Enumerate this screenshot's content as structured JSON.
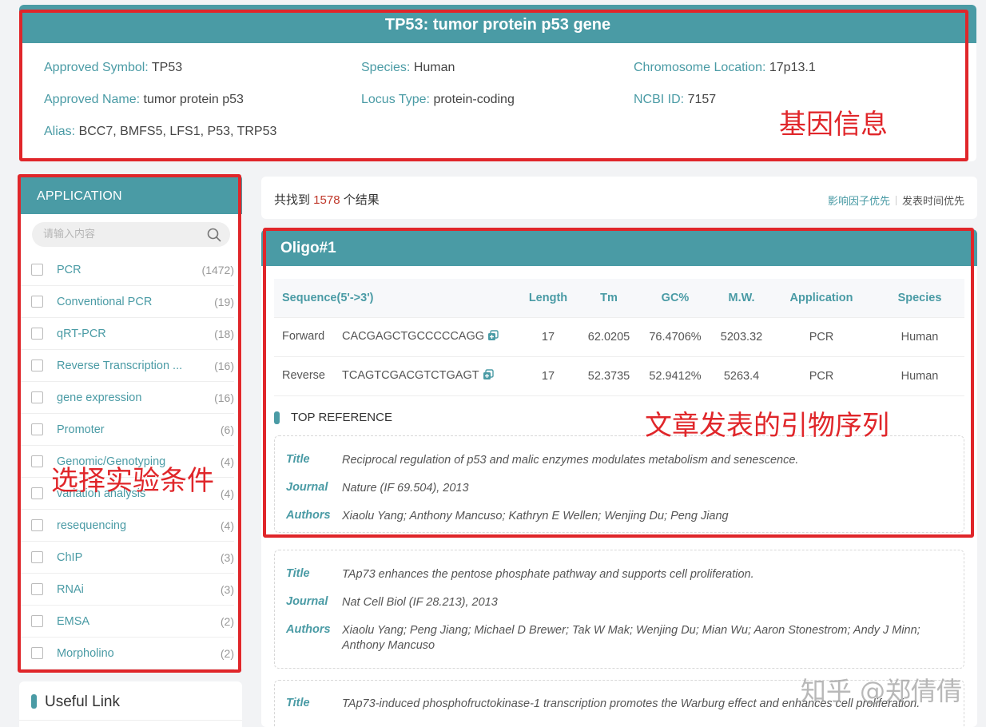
{
  "gene": {
    "title": "TP53: tumor protein p53 gene",
    "fields": {
      "approved_symbol_label": "Approved Symbol:",
      "approved_symbol": "TP53",
      "species_label": "Species:",
      "species": "Human",
      "chrom_label": "Chromosome Location:",
      "chrom": "17p13.1",
      "approved_name_label": "Approved Name:",
      "approved_name": "tumor protein p53",
      "locus_label": "Locus Type:",
      "locus": "protein-coding",
      "ncbi_label": "NCBI ID:",
      "ncbi": "7157",
      "alias_label": "Alias:",
      "alias": "BCC7, BMFS5, LFS1, P53, TRP53"
    }
  },
  "sidebar": {
    "title": "APPLICATION",
    "search_placeholder": "请输入内容",
    "items": [
      {
        "label": "PCR",
        "count": "(1472)"
      },
      {
        "label": "Conventional PCR",
        "count": "(19)"
      },
      {
        "label": "qRT-PCR",
        "count": "(18)"
      },
      {
        "label": "Reverse Transcription ...",
        "count": "(16)"
      },
      {
        "label": "gene expression",
        "count": "(16)"
      },
      {
        "label": "Promoter",
        "count": "(6)"
      },
      {
        "label": "Genomic/Genotyping",
        "count": "(4)"
      },
      {
        "label": "variation analysis",
        "count": "(4)"
      },
      {
        "label": "resequencing",
        "count": "(4)"
      },
      {
        "label": "ChIP",
        "count": "(3)"
      },
      {
        "label": "RNAi",
        "count": "(3)"
      },
      {
        "label": "EMSA",
        "count": "(2)"
      },
      {
        "label": "Morpholino",
        "count": "(2)"
      }
    ],
    "useful_link": "Useful Link"
  },
  "results": {
    "prefix": "共找到 ",
    "count": "1578",
    "suffix": " 个结果",
    "sort_impact": "影响因子优先",
    "sort_time": "发表时间优先"
  },
  "oligo": {
    "title": "Oligo#1",
    "headers": [
      "Sequence(5'->3')",
      "Length",
      "Tm",
      "GC%",
      "M.W.",
      "Application",
      "Species"
    ],
    "rows": [
      {
        "dir": "Forward",
        "seq": "CACGAGCTGCCCCCAGG",
        "length": "17",
        "tm": "62.0205",
        "gc": "76.4706%",
        "mw": "5203.32",
        "app": "PCR",
        "species": "Human"
      },
      {
        "dir": "Reverse",
        "seq": "TCAGTCGACGTCTGAGT",
        "length": "17",
        "tm": "52.3735",
        "gc": "52.9412%",
        "mw": "5263.4",
        "app": "PCR",
        "species": "Human"
      }
    ],
    "top_reference": "TOP REFERENCE",
    "labels": {
      "title": "Title",
      "journal": "Journal",
      "authors": "Authors"
    },
    "references": [
      {
        "title": "Reciprocal regulation of p53 and malic enzymes modulates metabolism and senescence.",
        "journal": "Nature (IF 69.504), 2013",
        "authors": "Xiaolu Yang; Anthony Mancuso; Kathryn E Wellen; Wenjing Du; Peng Jiang"
      },
      {
        "title": "TAp73 enhances the pentose phosphate pathway and supports cell proliferation.",
        "journal": "Nat Cell Biol (IF 28.213), 2013",
        "authors": "Xiaolu Yang; Peng Jiang; Michael D Brewer; Tak W Mak; Wenjing Du; Mian Wu; Aaron Stonestrom; Andy J Minn; Anthony Mancuso"
      },
      {
        "title": "TAp73-induced phosphofructokinase-1 transcription promotes the Warburg effect and enhances cell proliferation."
      }
    ]
  },
  "annotations": {
    "gene_info": "基因信息",
    "select_conditions": "选择实验条件",
    "published_primers": "文章发表的引物序列",
    "watermark": "知乎 @郑倩倩",
    "color": "#e0262a"
  },
  "colors": {
    "accent": "#4a9ba5",
    "count_highlight": "#c0392b"
  }
}
